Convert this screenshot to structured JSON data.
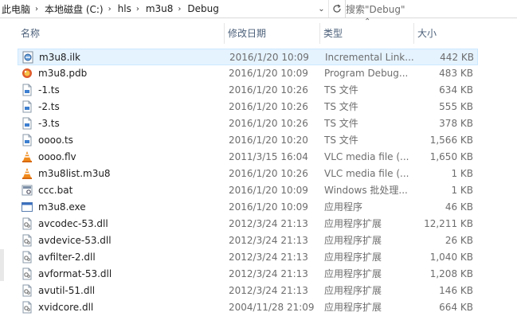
{
  "address": {
    "crumbs": [
      "此电脑",
      "本地磁盘 (C:)",
      "hls",
      "m3u8",
      "Debug"
    ],
    "search_placeholder": "搜索\"Debug\""
  },
  "columns": {
    "name": "名称",
    "date": "修改日期",
    "type": "类型",
    "size": "大小"
  },
  "files": [
    {
      "name": "m3u8.ilk",
      "date": "2016/1/20 10:09",
      "type": "Incremental Link...",
      "size": "442 KB",
      "icon": "ilk-file-icon"
    },
    {
      "name": "m3u8.pdb",
      "date": "2016/1/20 10:09",
      "type": "Program Debug...",
      "size": "483 KB",
      "icon": "pdb-file-icon"
    },
    {
      "name": "-1.ts",
      "date": "2016/1/20 10:26",
      "type": "TS 文件",
      "size": "634 KB",
      "icon": "ts-file-icon"
    },
    {
      "name": "-2.ts",
      "date": "2016/1/20 10:26",
      "type": "TS 文件",
      "size": "555 KB",
      "icon": "ts-file-icon"
    },
    {
      "name": "-3.ts",
      "date": "2016/1/20 10:26",
      "type": "TS 文件",
      "size": "378 KB",
      "icon": "ts-file-icon"
    },
    {
      "name": "oooo.ts",
      "date": "2016/1/20 10:20",
      "type": "TS 文件",
      "size": "1,566 KB",
      "icon": "ts-file-icon"
    },
    {
      "name": "oooo.flv",
      "date": "2011/3/15 16:04",
      "type": "VLC media file (...",
      "size": "1,650 KB",
      "icon": "vlc-cone-icon"
    },
    {
      "name": "m3u8list.m3u8",
      "date": "2016/1/20 10:26",
      "type": "VLC media file (...",
      "size": "1 KB",
      "icon": "vlc-cone-icon"
    },
    {
      "name": "ccc.bat",
      "date": "2016/1/20 10:09",
      "type": "Windows 批处理...",
      "size": "1 KB",
      "icon": "bat-file-icon"
    },
    {
      "name": "m3u8.exe",
      "date": "2016/1/20 10:09",
      "type": "应用程序",
      "size": "46 KB",
      "icon": "exe-file-icon"
    },
    {
      "name": "avcodec-53.dll",
      "date": "2012/3/24 21:13",
      "type": "应用程序扩展",
      "size": "12,211 KB",
      "icon": "dll-file-icon"
    },
    {
      "name": "avdevice-53.dll",
      "date": "2012/3/24 21:13",
      "type": "应用程序扩展",
      "size": "26 KB",
      "icon": "dll-file-icon"
    },
    {
      "name": "avfilter-2.dll",
      "date": "2012/3/24 21:13",
      "type": "应用程序扩展",
      "size": "1,040 KB",
      "icon": "dll-file-icon"
    },
    {
      "name": "avformat-53.dll",
      "date": "2012/3/24 21:13",
      "type": "应用程序扩展",
      "size": "1,208 KB",
      "icon": "dll-file-icon"
    },
    {
      "name": "avutil-51.dll",
      "date": "2012/3/24 21:13",
      "type": "应用程序扩展",
      "size": "146 KB",
      "icon": "dll-file-icon"
    },
    {
      "name": "xvidcore.dll",
      "date": "2004/11/28 21:09",
      "type": "应用程序扩展",
      "size": "664 KB",
      "icon": "dll-file-icon"
    }
  ],
  "selected_index": 0
}
